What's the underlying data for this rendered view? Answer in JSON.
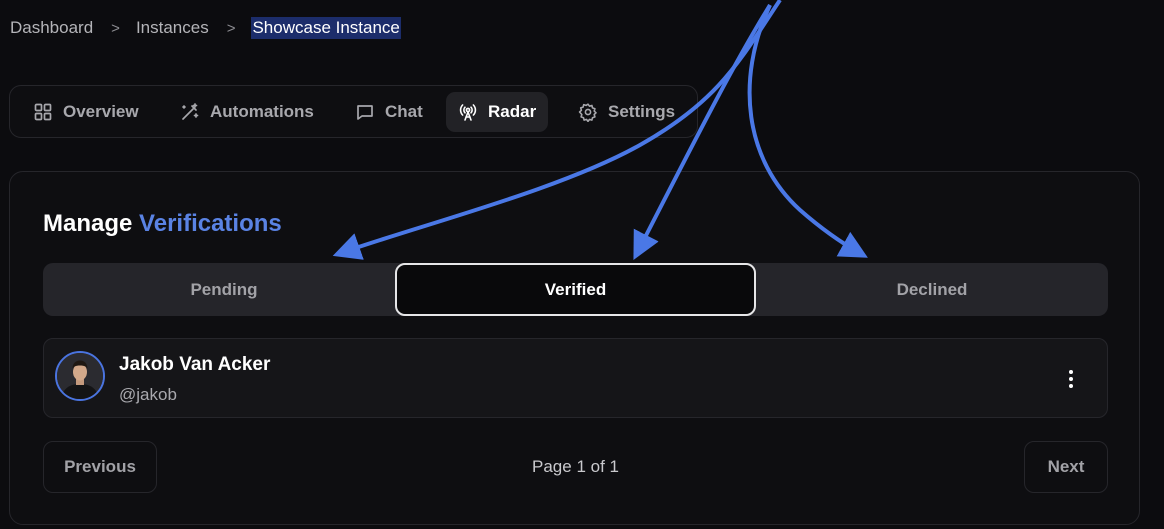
{
  "breadcrumb": {
    "items": [
      "Dashboard",
      "Instances",
      "Showcase Instance"
    ],
    "separator": ">"
  },
  "tabs": [
    {
      "label": "Overview",
      "icon": "grid-icon"
    },
    {
      "label": "Automations",
      "icon": "magic-wand-icon"
    },
    {
      "label": "Chat",
      "icon": "chat-icon"
    },
    {
      "label": "Radar",
      "icon": "radar-icon",
      "active": true
    },
    {
      "label": "Settings",
      "icon": "gear-icon"
    }
  ],
  "section": {
    "title_prefix": "Manage",
    "title_accent": "Verifications"
  },
  "segments": [
    {
      "label": "Pending"
    },
    {
      "label": "Verified",
      "active": true
    },
    {
      "label": "Declined"
    }
  ],
  "user": {
    "name": "Jakob Van Acker",
    "handle": "@jakob"
  },
  "pagination": {
    "previous": "Previous",
    "page_info": "Page 1 of 1",
    "next": "Next"
  },
  "colors": {
    "accent": "#5a83e4",
    "annotation_arrow": "#4a78e6",
    "background": "#0c0c0f"
  }
}
